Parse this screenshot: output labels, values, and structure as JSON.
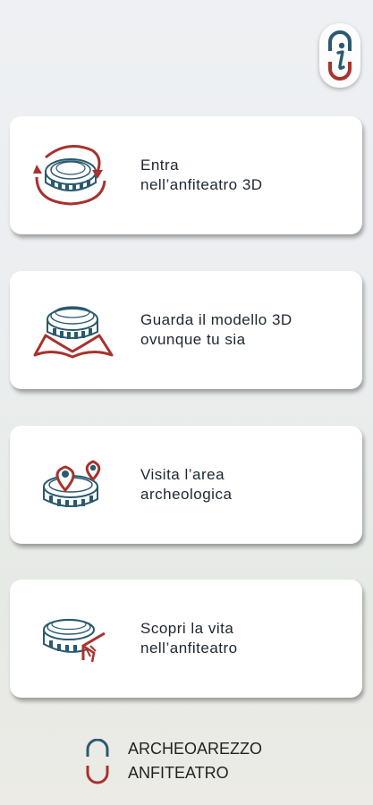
{
  "colors": {
    "teal": "#2a5a6e",
    "red": "#a8322d"
  },
  "info_button": {
    "icon": "info-icon"
  },
  "menu": [
    {
      "id": "enter-3d",
      "label": "Entra\nnell’anfiteatro 3D",
      "icon": "rotating-arena-icon"
    },
    {
      "id": "view-model",
      "label": "Guarda il modello 3D\novunque tu sia",
      "icon": "arena-book-icon"
    },
    {
      "id": "visit-area",
      "label": "Visita l’area\narcheologica",
      "icon": "arena-location-pins-icon"
    },
    {
      "id": "discover-life",
      "label": "Scopri la vita\nnell’anfiteatro",
      "icon": "arena-scene-icon"
    }
  ],
  "footer": {
    "line1": "ARCHEOAREZZO",
    "line2": "ANFITEATRO"
  }
}
